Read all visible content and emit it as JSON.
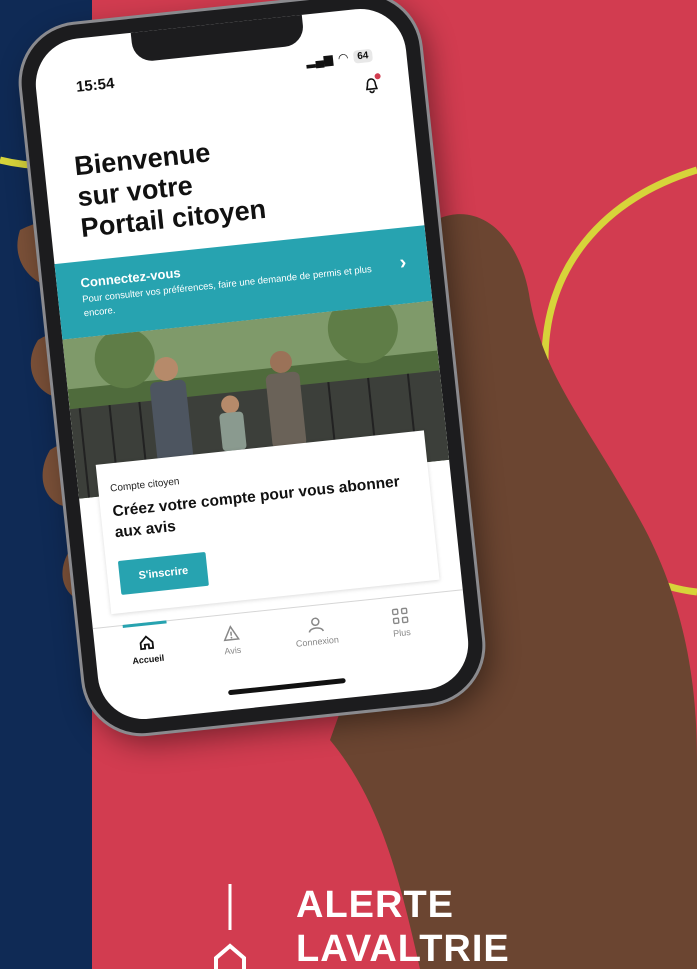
{
  "colors": {
    "navy": "#0f2a55",
    "red": "#d23c50",
    "yellow": "#d7d43a",
    "teal": "#27a3b0",
    "skin": "#6b4531"
  },
  "status_bar": {
    "time": "15:54",
    "signal_icon": "signal-icon",
    "wifi_icon": "wifi-icon",
    "battery_level": "64"
  },
  "header": {
    "notification_icon": "bell-icon",
    "title_lines": [
      "Bienvenue",
      "sur votre",
      "Portail citoyen"
    ]
  },
  "login_banner": {
    "title": "Connectez-vous",
    "description": "Pour consulter vos préférences, faire une demande de permis et plus encore.",
    "arrow": "›"
  },
  "citizen_card": {
    "kicker": "Compte citoyen",
    "title": "Créez votre compte pour vous abonner aux avis",
    "button_label": "S'inscrire"
  },
  "tab_bar": {
    "tabs": [
      {
        "label": "Accueil",
        "icon": "home-icon",
        "active": true
      },
      {
        "label": "Avis",
        "icon": "warning-icon",
        "active": false
      },
      {
        "label": "Connexion",
        "icon": "user-icon",
        "active": false
      },
      {
        "label": "Plus",
        "icon": "grid-icon",
        "active": false
      }
    ]
  },
  "brand": {
    "line1": "ALERTE",
    "line2": "LAVALTRIE"
  }
}
